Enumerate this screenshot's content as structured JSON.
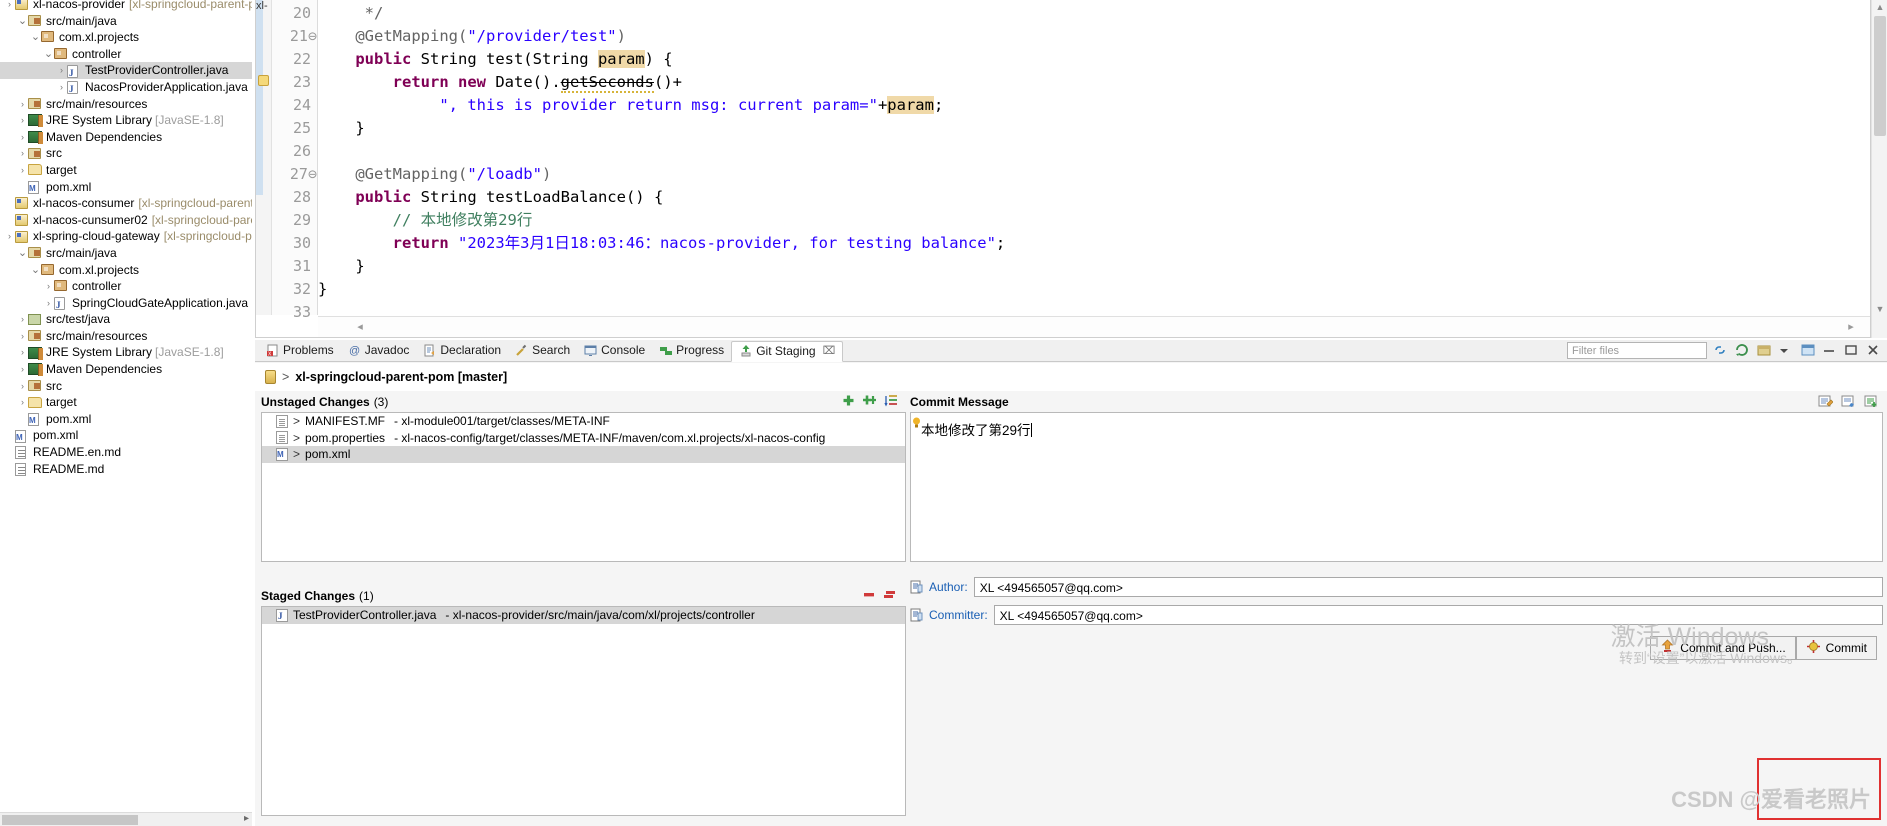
{
  "explorer": {
    "items": [
      {
        "indent": 0,
        "arrow": "›",
        "icon": "project-icon",
        "label": "xl-nacos-provider",
        "suffix": "[xl-springcloud-parent-pom",
        "selected": false
      },
      {
        "indent": 1,
        "arrow": "⌄",
        "icon": "source-folder-icon",
        "label": "src/main/java",
        "suffix": "",
        "selected": false
      },
      {
        "indent": 2,
        "arrow": "⌄",
        "icon": "package-icon",
        "label": "com.xl.projects",
        "suffix": "",
        "selected": false
      },
      {
        "indent": 3,
        "arrow": "⌄",
        "icon": "package-icon",
        "label": "controller",
        "suffix": "",
        "selected": false
      },
      {
        "indent": 4,
        "arrow": "›",
        "icon": "java-file-icon",
        "label": "TestProviderController.java",
        "suffix": "",
        "selected": true
      },
      {
        "indent": 4,
        "arrow": "›",
        "icon": "java-file-icon",
        "label": "NacosProviderApplication.java",
        "suffix": "",
        "selected": false
      },
      {
        "indent": 1,
        "arrow": "›",
        "icon": "source-folder-icon",
        "label": "src/main/resources",
        "suffix": "",
        "selected": false
      },
      {
        "indent": 1,
        "arrow": "›",
        "icon": "library-icon",
        "label": "JRE System Library",
        "suffix": "[JavaSE-1.8]",
        "library": true,
        "selected": false
      },
      {
        "indent": 1,
        "arrow": "›",
        "icon": "library-icon",
        "label": "Maven Dependencies",
        "suffix": "",
        "selected": false
      },
      {
        "indent": 1,
        "arrow": "›",
        "icon": "source-folder-icon",
        "label": "src",
        "suffix": "",
        "selected": false
      },
      {
        "indent": 1,
        "arrow": "›",
        "icon": "folder-icon",
        "label": "target",
        "suffix": "",
        "selected": false
      },
      {
        "indent": 1,
        "arrow": "",
        "icon": "maven-pom-icon",
        "label": "pom.xml",
        "suffix": "",
        "selected": false
      },
      {
        "indent": 0,
        "arrow": "",
        "icon": "project-icon",
        "label": "xl-nacos-consumer",
        "suffix": "[xl-springcloud-parent-por",
        "selected": false
      },
      {
        "indent": 0,
        "arrow": "",
        "icon": "project-icon",
        "label": "xl-nacos-cunsumer02",
        "suffix": "[xl-springcloud-parent-p",
        "selected": false
      },
      {
        "indent": 0,
        "arrow": "›",
        "icon": "project-icon",
        "label": "xl-spring-cloud-gateway",
        "suffix": "[xl-springcloud-paren",
        "selected": false
      },
      {
        "indent": 1,
        "arrow": "⌄",
        "icon": "source-folder-icon",
        "label": "src/main/java",
        "suffix": "",
        "selected": false
      },
      {
        "indent": 2,
        "arrow": "⌄",
        "icon": "package-icon",
        "label": "com.xl.projects",
        "suffix": "",
        "selected": false
      },
      {
        "indent": 3,
        "arrow": "›",
        "icon": "package-icon",
        "label": "controller",
        "suffix": "",
        "selected": false
      },
      {
        "indent": 3,
        "arrow": "›",
        "icon": "java-file-icon",
        "label": "SpringCloudGateApplication.java",
        "suffix": "",
        "selected": false
      },
      {
        "indent": 1,
        "arrow": "›",
        "icon": "test-folder-icon",
        "label": "src/test/java",
        "suffix": "",
        "selected": false
      },
      {
        "indent": 1,
        "arrow": "›",
        "icon": "source-folder-icon",
        "label": "src/main/resources",
        "suffix": "",
        "selected": false
      },
      {
        "indent": 1,
        "arrow": "›",
        "icon": "library-icon",
        "label": "JRE System Library",
        "suffix": "[JavaSE-1.8]",
        "library": true,
        "selected": false
      },
      {
        "indent": 1,
        "arrow": "›",
        "icon": "library-icon",
        "label": "Maven Dependencies",
        "suffix": "",
        "selected": false
      },
      {
        "indent": 1,
        "arrow": "›",
        "icon": "source-folder-icon",
        "label": "src",
        "suffix": "",
        "selected": false
      },
      {
        "indent": 1,
        "arrow": "›",
        "icon": "folder-icon",
        "label": "target",
        "suffix": "",
        "selected": false
      },
      {
        "indent": 1,
        "arrow": "",
        "icon": "maven-pom-icon",
        "label": "pom.xml",
        "suffix": "",
        "selected": false
      },
      {
        "indent": 0,
        "arrow": "",
        "icon": "maven-pom-icon",
        "label": "pom.xml",
        "suffix": "",
        "selected": false
      },
      {
        "indent": 0,
        "arrow": "",
        "icon": "markdown-icon",
        "label": "README.en.md",
        "suffix": "",
        "selected": false
      },
      {
        "indent": 0,
        "arrow": "",
        "icon": "markdown-icon",
        "label": "README.md",
        "suffix": "",
        "selected": false
      }
    ]
  },
  "editor": {
    "tab_hint": "xl-springcloud-parent-pom",
    "lines": [
      {
        "num": "20",
        "fold": "",
        "segments": [
          {
            "t": "     ",
            "c": ""
          },
          {
            "t": "*/",
            "c": "ann"
          }
        ]
      },
      {
        "num": "21",
        "fold": "⊖",
        "segments": [
          {
            "t": "    ",
            "c": ""
          },
          {
            "t": "@GetMapping(",
            "c": "ann"
          },
          {
            "t": "\"/provider/test\"",
            "c": "str"
          },
          {
            "t": ")",
            "c": "ann"
          }
        ]
      },
      {
        "num": "22",
        "fold": "",
        "segments": [
          {
            "t": "    ",
            "c": ""
          },
          {
            "t": "public",
            "c": "kw"
          },
          {
            "t": " String test(String ",
            "c": ""
          },
          {
            "t": "param",
            "c": "hl"
          },
          {
            "t": ") {",
            "c": ""
          }
        ]
      },
      {
        "num": "23",
        "fold": "",
        "segments": [
          {
            "t": "        ",
            "c": ""
          },
          {
            "t": "return",
            "c": "kw"
          },
          {
            "t": " ",
            "c": ""
          },
          {
            "t": "new",
            "c": "kw"
          },
          {
            "t": " Date().",
            "c": ""
          },
          {
            "t": "getSeconds",
            "c": "strike warnu"
          },
          {
            "t": "()+",
            "c": ""
          }
        ]
      },
      {
        "num": "24",
        "fold": "",
        "segments": [
          {
            "t": "             ",
            "c": ""
          },
          {
            "t": "\", this is provider return msg: current param=\"",
            "c": "str"
          },
          {
            "t": "+",
            "c": ""
          },
          {
            "t": "param",
            "c": "hl"
          },
          {
            "t": ";",
            "c": ""
          }
        ]
      },
      {
        "num": "25",
        "fold": "",
        "segments": [
          {
            "t": "    }",
            "c": ""
          }
        ]
      },
      {
        "num": "26",
        "fold": "",
        "segments": [
          {
            "t": "",
            "c": ""
          }
        ]
      },
      {
        "num": "27",
        "fold": "⊖",
        "segments": [
          {
            "t": "    ",
            "c": ""
          },
          {
            "t": "@GetMapping(",
            "c": "ann"
          },
          {
            "t": "\"/loadb\"",
            "c": "str"
          },
          {
            "t": ")",
            "c": "ann"
          }
        ]
      },
      {
        "num": "28",
        "fold": "",
        "segments": [
          {
            "t": "    ",
            "c": ""
          },
          {
            "t": "public",
            "c": "kw"
          },
          {
            "t": " String testLoadBalance() {",
            "c": ""
          }
        ]
      },
      {
        "num": "29",
        "fold": "",
        "segments": [
          {
            "t": "        ",
            "c": ""
          },
          {
            "t": "// 本地修改第29行",
            "c": "cmt"
          }
        ]
      },
      {
        "num": "30",
        "fold": "",
        "segments": [
          {
            "t": "        ",
            "c": ""
          },
          {
            "t": "return",
            "c": "kw"
          },
          {
            "t": " ",
            "c": ""
          },
          {
            "t": "\"2023年3月1日18:03:46：nacos-provider, for testing balance\"",
            "c": "str"
          },
          {
            "t": ";",
            "c": ""
          }
        ]
      },
      {
        "num": "31",
        "fold": "",
        "segments": [
          {
            "t": "    }",
            "c": ""
          }
        ]
      },
      {
        "num": "32",
        "fold": "",
        "segments": [
          {
            "t": "}",
            "c": ""
          }
        ]
      },
      {
        "num": "33",
        "fold": "",
        "segments": [
          {
            "t": "",
            "c": ""
          }
        ]
      }
    ]
  },
  "bottom": {
    "tabs": [
      {
        "label": "Problems",
        "icon": "problems-icon",
        "active": false,
        "closable": false
      },
      {
        "label": "Javadoc",
        "icon": "javadoc-icon",
        "active": false,
        "closable": false
      },
      {
        "label": "Declaration",
        "icon": "declaration-icon",
        "active": false,
        "closable": false
      },
      {
        "label": "Search",
        "icon": "search-icon",
        "active": false,
        "closable": false
      },
      {
        "label": "Console",
        "icon": "console-icon",
        "active": false,
        "closable": false
      },
      {
        "label": "Progress",
        "icon": "progress-icon",
        "active": false,
        "closable": false
      },
      {
        "label": "Git Staging",
        "icon": "git-staging-icon",
        "active": true,
        "closable": true,
        "close_glyph": "⌧"
      }
    ],
    "filter_placeholder": "Filter files",
    "toolbar_icons": [
      "link-selection-icon",
      "refresh-icon",
      "stash-icon",
      "menu-dropdown-icon",
      "maximize-icon",
      "minimize-icon",
      "restore-icon",
      "close-icon"
    ],
    "repository": {
      "icon": "repository-icon",
      "caret": ">",
      "name": "xl-springcloud-parent-pom [master]"
    },
    "unstaged": {
      "title": "Unstaged Changes",
      "count": "(3)",
      "tools": [
        "add-icon",
        "add-all-icon",
        "sort-icon"
      ],
      "items": [
        {
          "icon": "fi-doc",
          "prefix": ">",
          "name": "MANIFEST.MF",
          "path": "- xl-module001/target/classes/META-INF",
          "selected": false
        },
        {
          "icon": "fi-doc",
          "prefix": ">",
          "name": "pom.properties",
          "path": "- xl-nacos-config/target/classes/META-INF/maven/com.xl.projects/xl-nacos-config",
          "selected": false
        },
        {
          "icon": "fi-xml",
          "prefix": ">",
          "name": "pom.xml",
          "path": "",
          "selected": true
        }
      ]
    },
    "staged": {
      "title": "Staged Changes",
      "count": "(1)",
      "tools": [
        "remove-icon",
        "remove-all-icon"
      ],
      "items": [
        {
          "icon": "fi-java",
          "prefix": "",
          "name": "TestProviderController.java",
          "path": "- xl-nacos-provider/src/main/java/com/xl/projects/controller",
          "selected": true
        }
      ]
    },
    "commit": {
      "title": "Commit Message",
      "message": "本地修改了第29行",
      "header_icons": [
        "amend-icon",
        "signed-off-icon",
        "add-change-id-icon"
      ],
      "author_label": "Author:",
      "author_value": "XL <494565057@qq.com>",
      "committer_label": "Committer:",
      "committer_value": "XL <494565057@qq.com>",
      "commit_push_label": "Commit and Push...",
      "commit_label": "Commit"
    }
  },
  "watermarks": {
    "windows_title": "激活 Windows",
    "windows_sub": "转到“设置”以激活 Windows。",
    "csdn": "CSDN @爱看老照片"
  }
}
